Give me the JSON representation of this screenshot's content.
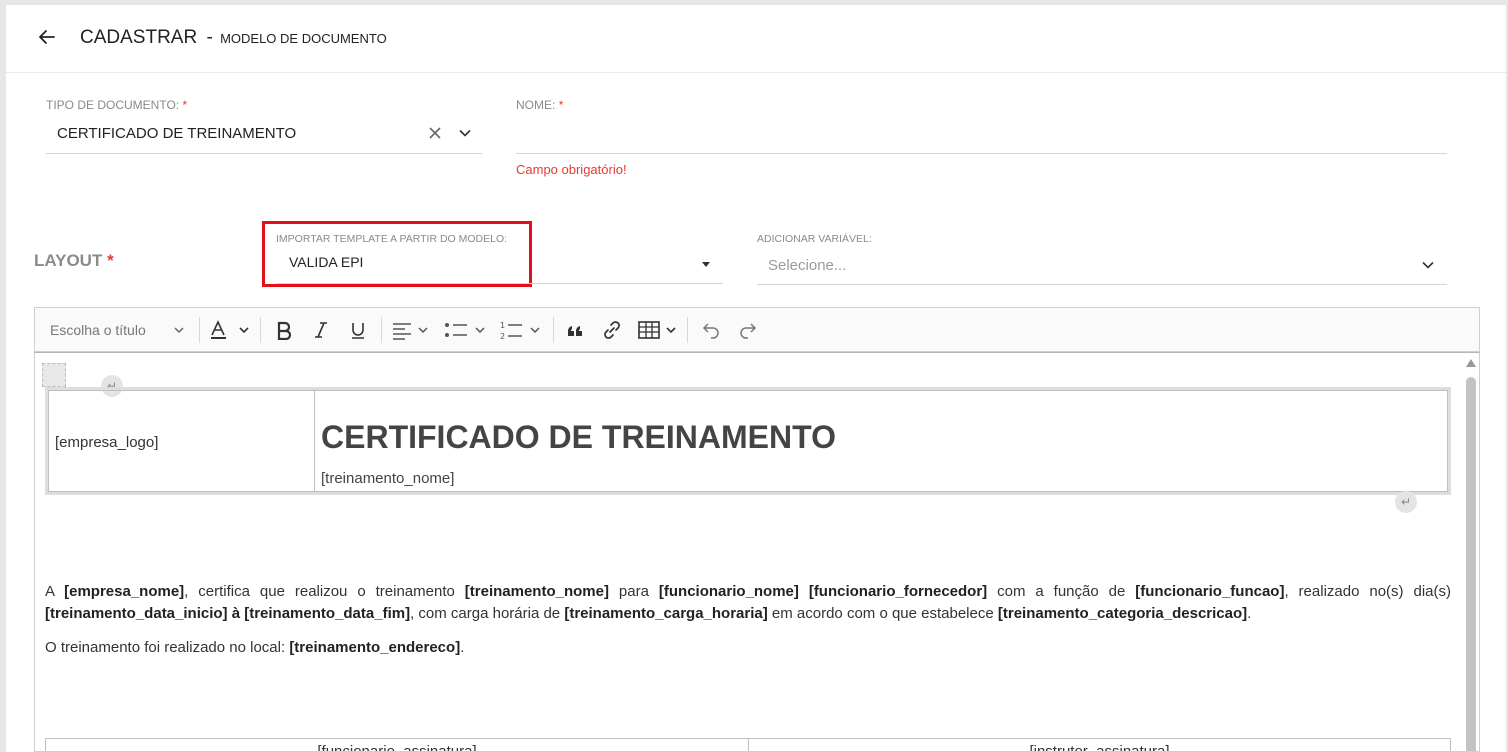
{
  "header": {
    "title": "CADASTRAR",
    "separator": "-",
    "subtitle": "MODELO DE DOCUMENTO"
  },
  "form": {
    "tipo_documento": {
      "label": "TIPO DE DOCUMENTO:",
      "required": "*",
      "value": "CERTIFICADO DE TREINAMENTO"
    },
    "nome": {
      "label": "NOME:",
      "required": "*",
      "value": "",
      "error": "Campo obrigatório!"
    }
  },
  "layout": {
    "label": "LAYOUT",
    "required": "*",
    "importar": {
      "label": "IMPORTAR TEMPLATE A PARTIR DO MODELO:",
      "value": "VALIDA EPI"
    },
    "adicionar_variavel": {
      "label": "ADICIONAR VARIÁVEL:",
      "placeholder": "Selecione..."
    }
  },
  "toolbar": {
    "heading_select": "Escolha o título",
    "icons": [
      "font-color-icon",
      "bold-icon",
      "italic-icon",
      "underline-icon",
      "align-icon",
      "bulleted-list-icon",
      "numbered-list-icon",
      "blockquote-icon",
      "link-icon",
      "table-icon",
      "undo-icon",
      "redo-icon"
    ]
  },
  "document": {
    "logo_placeholder": "[empresa_logo]",
    "heading": "CERTIFICADO DE TREINAMENTO",
    "heading_sub": "[treinamento_nome]",
    "p1": {
      "t1": "A ",
      "b1": "[empresa_nome]",
      "t2": ", certifica que realizou o treinamento ",
      "b2": "[treinamento_nome]",
      "t3": " para ",
      "b3": "[funcionario_nome] [funcionario_fornecedor]",
      "t4": " com a função de ",
      "b4": "[funcionario_funcao]",
      "t5": ", realizado no(s) dia(s) ",
      "b5": "[treinamento_data_inicio] à [treinamento_data_fim]",
      "t6": ", com carga horária de ",
      "b6": "[treinamento_carga_horaria]",
      "t7": " em acordo com o que estabelece ",
      "b7": "[treinamento_categoria_descricao]",
      "t8": "."
    },
    "p2": {
      "t1": "O treinamento foi realizado no local: ",
      "b1": "[treinamento_endereco]",
      "t2": "."
    },
    "signatures": {
      "left": "[funcionario_assinatura]",
      "right": "[instrutor_assinatura]"
    }
  },
  "colors": {
    "required": "#e53935",
    "highlight_box": "#e0111b"
  }
}
